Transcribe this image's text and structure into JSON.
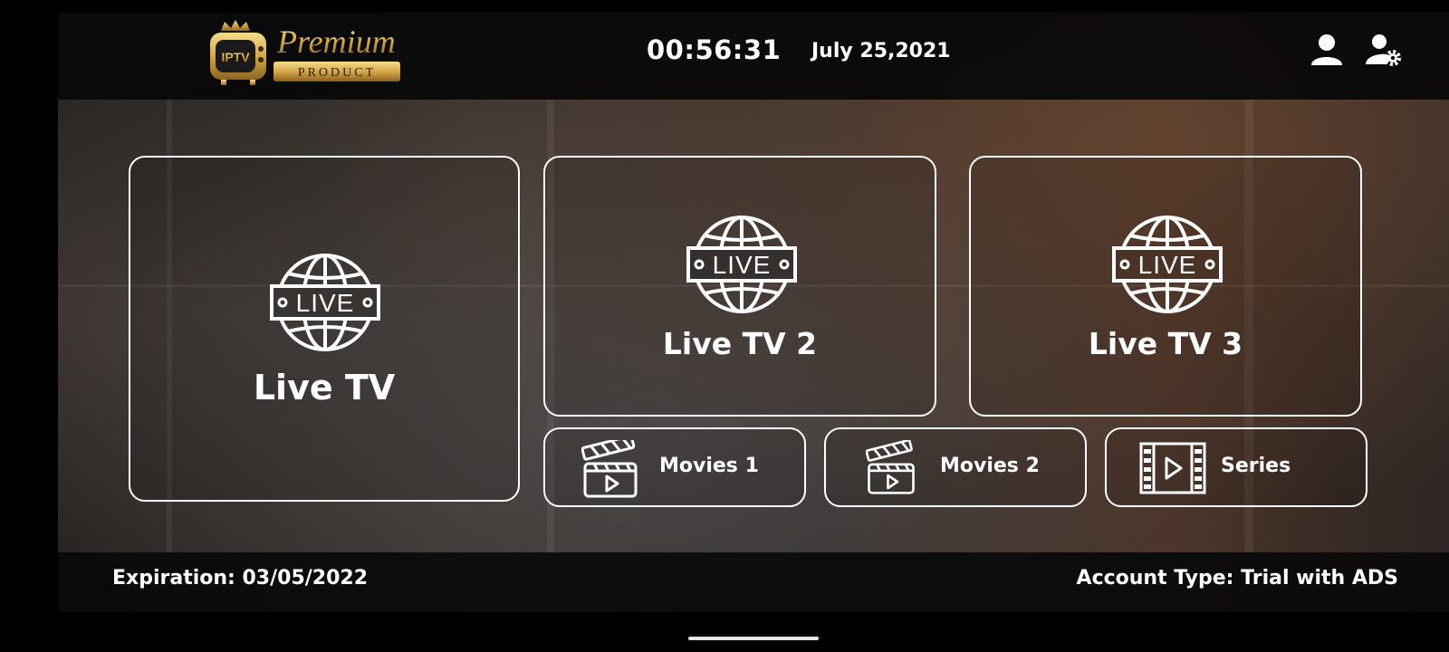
{
  "brand": {
    "badge": "IPTV",
    "title": "Premium",
    "subtitle": "PRODUCT",
    "gold": "#d4a84a"
  },
  "header": {
    "time": "00:56:31",
    "date": "July 25,2021"
  },
  "icons": {
    "profile": "user-icon",
    "settings": "user-settings-icon",
    "live": "live-globe-icon",
    "movies": "clapperboard-icon",
    "series": "film-strip-icon"
  },
  "tiles": {
    "live_tv": "Live TV",
    "live_tv_2": "Live TV 2",
    "live_tv_3": "Live TV 3",
    "movies_1": "Movies 1",
    "movies_2": "Movies 2",
    "series": "Series",
    "live_badge": "LIVE"
  },
  "footer": {
    "expiration": "Expiration: 03/05/2022",
    "account_type": "Account Type: Trial with ADS"
  }
}
